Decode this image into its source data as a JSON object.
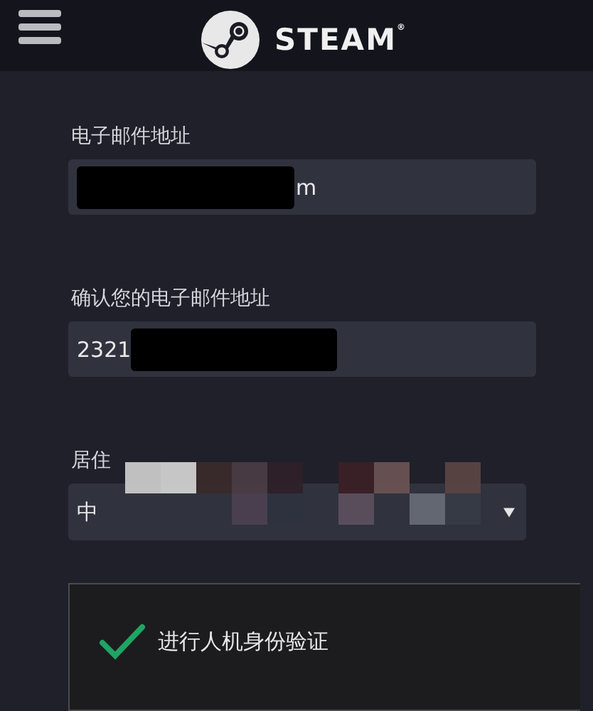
{
  "header": {
    "brand": "STEAM$^{®}$"
  },
  "form": {
    "fields": [
      {
        "kind": "text",
        "label": "电子邮件地址",
        "value": "m",
        "masked_start": true,
        "masked_end": false,
        "pixelated": false
      },
      {
        "kind": "text",
        "label": "确认您的电子邮件地址",
        "value": "2321",
        "masked_start": false,
        "masked_end": true,
        "pixelated": false
      },
      {
        "kind": "select",
        "label": "居住",
        "value": "中",
        "masked_start": false,
        "masked_end": false,
        "pixelated": true
      }
    ]
  },
  "captcha": {
    "label": "进行人机身份验证",
    "checked": true
  }
}
